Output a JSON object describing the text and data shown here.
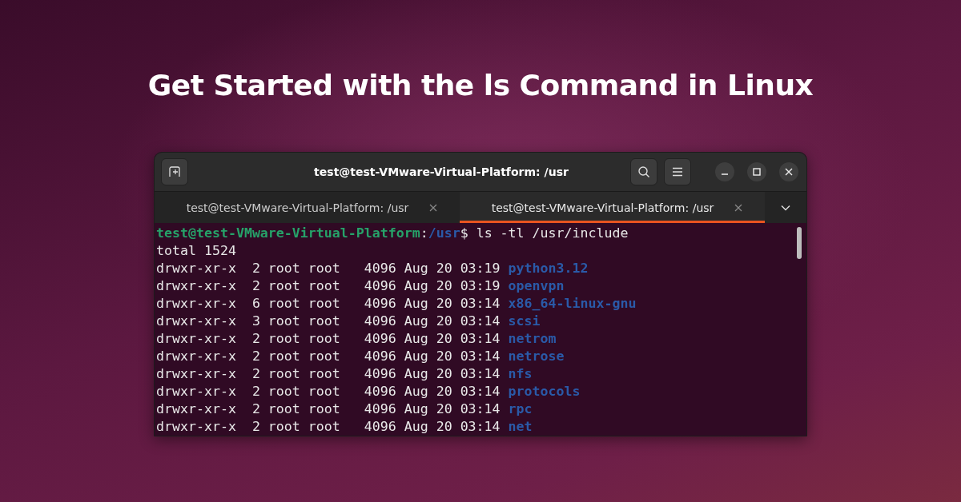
{
  "heading": "Get Started with the ls Command in Linux",
  "window": {
    "title": "test@test-VMware-Virtual-Platform: /usr",
    "tabs": [
      {
        "label": "test@test-VMware-Virtual-Platform: /usr",
        "selected": false
      },
      {
        "label": "test@test-VMware-Virtual-Platform: /usr",
        "selected": true
      }
    ],
    "terminal": {
      "prompt": {
        "user_host": "test@test-VMware-Virtual-Platform",
        "separator": ":",
        "path": "/usr",
        "symbol": "$",
        "command": " ls -tl /usr/include"
      },
      "lines": [
        {
          "kind": "text",
          "text": "total 1524"
        },
        {
          "kind": "entry",
          "info": "drwxr-xr-x  2 root root   4096 Aug 20 03:19",
          "name": "python3.12"
        },
        {
          "kind": "entry",
          "info": "drwxr-xr-x  2 root root   4096 Aug 20 03:19",
          "name": "openvpn"
        },
        {
          "kind": "entry",
          "info": "drwxr-xr-x  6 root root   4096 Aug 20 03:14",
          "name": "x86_64-linux-gnu"
        },
        {
          "kind": "entry",
          "info": "drwxr-xr-x  3 root root   4096 Aug 20 03:14",
          "name": "scsi"
        },
        {
          "kind": "entry",
          "info": "drwxr-xr-x  2 root root   4096 Aug 20 03:14",
          "name": "netrom"
        },
        {
          "kind": "entry",
          "info": "drwxr-xr-x  2 root root   4096 Aug 20 03:14",
          "name": "netrose"
        },
        {
          "kind": "entry",
          "info": "drwxr-xr-x  2 root root   4096 Aug 20 03:14",
          "name": "nfs"
        },
        {
          "kind": "entry",
          "info": "drwxr-xr-x  2 root root   4096 Aug 20 03:14",
          "name": "protocols"
        },
        {
          "kind": "entry",
          "info": "drwxr-xr-x  2 root root   4096 Aug 20 03:14",
          "name": "rpc"
        },
        {
          "kind": "entry",
          "info": "drwxr-xr-x  2 root root   4096 Aug 20 03:14",
          "name": "net"
        }
      ]
    }
  }
}
